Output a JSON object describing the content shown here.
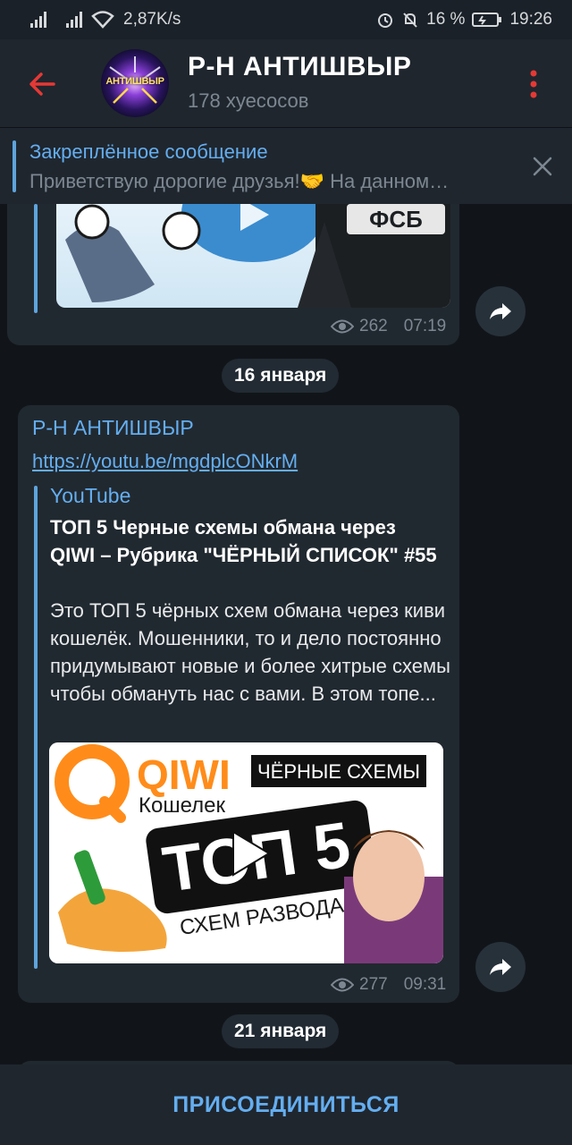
{
  "status_bar": {
    "speed": "2,87K/s",
    "battery": "16 %",
    "time": "19:26"
  },
  "header": {
    "title": "Р-Н АНТИШВЫР",
    "subtitle": "178 хуесосов",
    "avatar_text": "АНТИШВЫР"
  },
  "pinned": {
    "title": "Закреплённое сообщение",
    "text": "Приветствую дорогие друзья!🤝 На данном…"
  },
  "messages": [
    {
      "thumb_badge": "ФСБ",
      "views": "262",
      "time": "07:19"
    },
    {
      "date": "16 января",
      "sender": "Р-Н АНТИШВЫР",
      "link": "https://youtu.be/mgdplcONkrM",
      "preview": {
        "site": "YouTube",
        "title": "ТОП 5 Черные схемы обмана через QIWI – Рубрика \"ЧЁРНЫЙ СПИСОК\" #55",
        "description": "Это ТОП 5 чёрных схем обмана через киви кошелёк. Мошенники, то и дело постоянно придумывают новые и более хитрые схемы чтобы обмануть нас с вами. В этом топе...",
        "thumb_brand": "QIWI",
        "thumb_brand_sub": "Кошелек",
        "thumb_tag": "ЧЁРНЫЕ СХЕМЫ",
        "thumb_big": "ТОП 5",
        "thumb_caption": "СХЕМ РАЗВОДА"
      },
      "views": "277",
      "time": "09:31"
    }
  ],
  "date_2": "21 января",
  "join_label": "ПРИСОЕДИНИТЬСЯ",
  "colors": {
    "accent": "#64aef0",
    "back_arrow": "#e53935",
    "background": "#111519",
    "bubble": "#212930"
  }
}
